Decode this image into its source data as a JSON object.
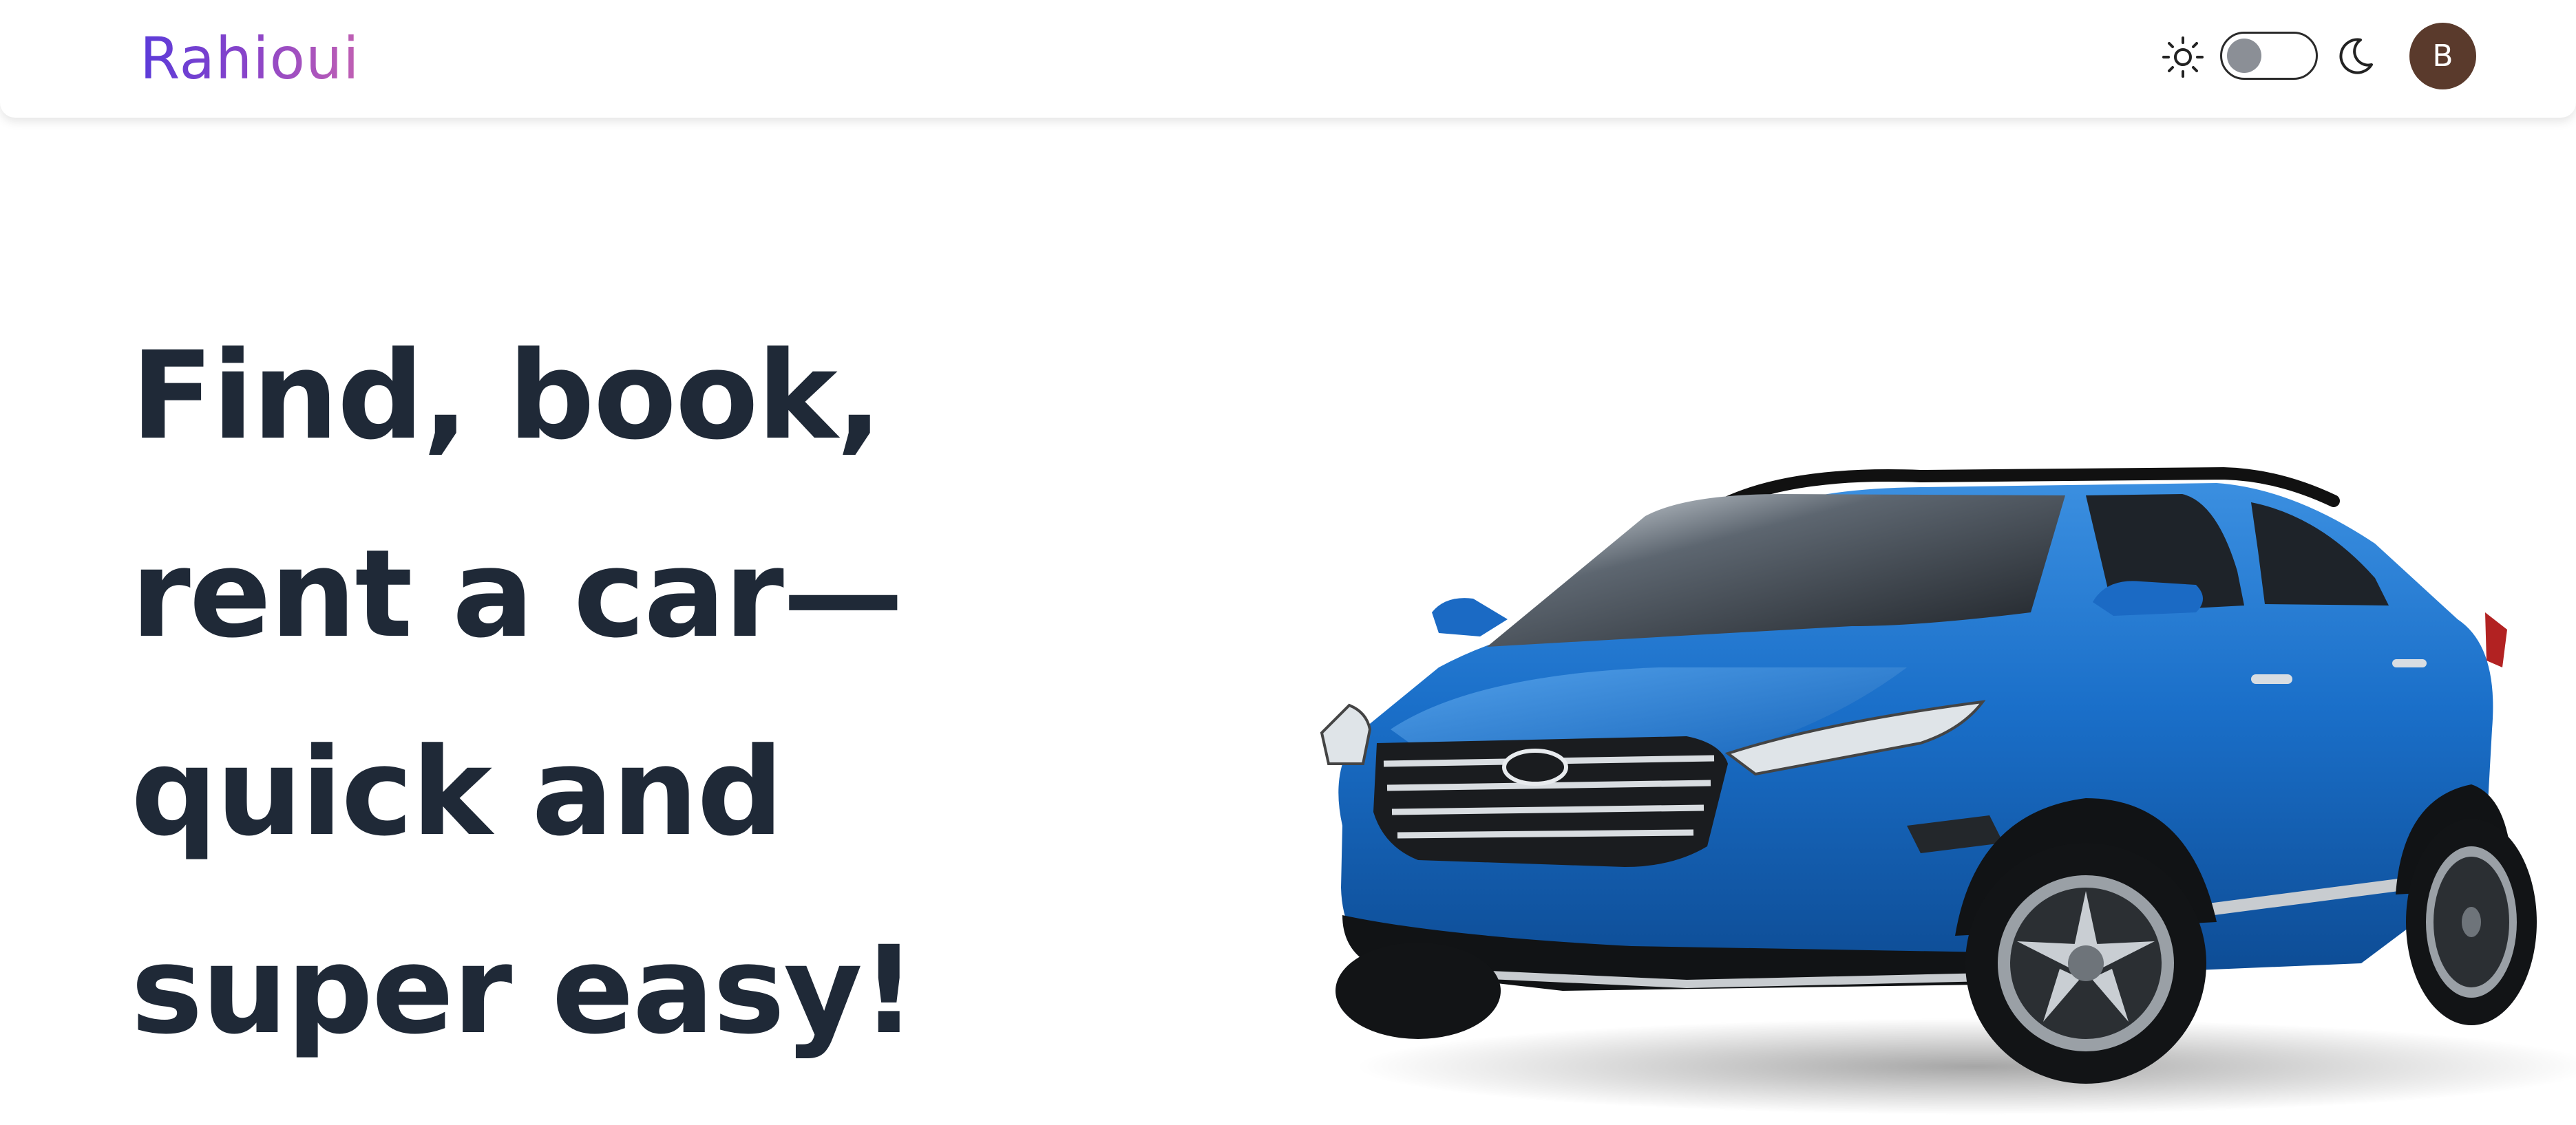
{
  "header": {
    "logo_text": "Rahioui",
    "theme_toggle": {
      "light_icon": "sun-icon",
      "dark_icon": "moon-icon",
      "state": "light"
    },
    "avatar_initial": "B"
  },
  "hero": {
    "title_lines": [
      "Find, book,",
      "rent a car—",
      "quick and",
      "super easy!"
    ],
    "image": "blue-suv-car"
  },
  "colors": {
    "title_text": "#1f2937",
    "logo_gradient_start": "#5b3bd9",
    "logo_gradient_end": "#c160b3",
    "avatar_bg": "#5a3a2c",
    "car_body": "#1a6fc9"
  }
}
